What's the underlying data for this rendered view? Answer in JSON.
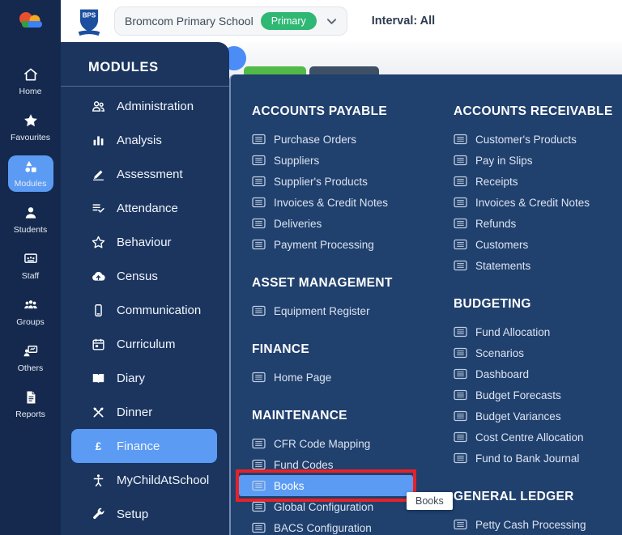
{
  "header": {
    "logo_icon": "bromcom-cloud-icon",
    "crest_icon": "crest-icon",
    "crest_text": "BPS",
    "school_selector": {
      "name": "Bromcom Primary School",
      "badge": "Primary"
    },
    "interval_label": "Interval: All"
  },
  "sidebar": {
    "items": [
      {
        "label": "Home",
        "icon": "home-icon",
        "active": false
      },
      {
        "label": "Favourites",
        "icon": "star-icon",
        "active": false
      },
      {
        "label": "Modules",
        "icon": "shapes-icon",
        "active": true
      },
      {
        "label": "Students",
        "icon": "person-icon",
        "active": false
      },
      {
        "label": "Staff",
        "icon": "staff-icon",
        "active": false
      },
      {
        "label": "Groups",
        "icon": "groups-icon",
        "active": false
      },
      {
        "label": "Others",
        "icon": "others-icon",
        "active": false
      },
      {
        "label": "Reports",
        "icon": "report-icon",
        "active": false
      }
    ]
  },
  "modules_menu": {
    "title": "MODULES",
    "items": [
      {
        "label": "Administration",
        "icon": "people-icon",
        "active": false
      },
      {
        "label": "Analysis",
        "icon": "bar-chart-icon",
        "active": false
      },
      {
        "label": "Assessment",
        "icon": "pencil-icon",
        "active": false
      },
      {
        "label": "Attendance",
        "icon": "list-check-icon",
        "active": false
      },
      {
        "label": "Behaviour",
        "icon": "star-outline-icon",
        "active": false
      },
      {
        "label": "Census",
        "icon": "cloud-upload-icon",
        "active": false
      },
      {
        "label": "Communication",
        "icon": "phone-icon",
        "active": false
      },
      {
        "label": "Curriculum",
        "icon": "calendar-icon",
        "active": false
      },
      {
        "label": "Diary",
        "icon": "book-icon",
        "active": false
      },
      {
        "label": "Dinner",
        "icon": "cutlery-icon",
        "active": false
      },
      {
        "label": "Finance",
        "icon": "pound-icon",
        "active": true
      },
      {
        "label": "MyChildAtSchool",
        "icon": "child-icon",
        "active": false
      },
      {
        "label": "Setup",
        "icon": "wrench-icon",
        "active": false
      }
    ]
  },
  "finance_flyout": {
    "tooltip": "Books",
    "columns": [
      {
        "sections": [
          {
            "title": "ACCOUNTS PAYABLE",
            "items": [
              {
                "label": "Purchase Orders"
              },
              {
                "label": "Suppliers"
              },
              {
                "label": "Supplier's Products"
              },
              {
                "label": "Invoices & Credit Notes"
              },
              {
                "label": "Deliveries"
              },
              {
                "label": "Payment Processing"
              }
            ]
          },
          {
            "title": "ASSET MANAGEMENT",
            "items": [
              {
                "label": "Equipment Register"
              }
            ]
          },
          {
            "title": "FINANCE",
            "items": [
              {
                "label": "Home Page"
              }
            ]
          },
          {
            "title": "MAINTENANCE",
            "items": [
              {
                "label": "CFR Code Mapping"
              },
              {
                "label": "Fund Codes"
              },
              {
                "label": "Books",
                "selected": true,
                "annotated": true
              },
              {
                "label": "Global Configuration"
              },
              {
                "label": "BACS Configuration"
              }
            ]
          }
        ]
      },
      {
        "sections": [
          {
            "title": "ACCOUNTS RECEIVABLE",
            "items": [
              {
                "label": "Customer's Products"
              },
              {
                "label": "Pay in Slips"
              },
              {
                "label": "Receipts"
              },
              {
                "label": "Invoices & Credit Notes"
              },
              {
                "label": "Refunds"
              },
              {
                "label": "Customers"
              },
              {
                "label": "Statements"
              }
            ]
          },
          {
            "title": "BUDGETING",
            "items": [
              {
                "label": "Fund Allocation"
              },
              {
                "label": "Scenarios"
              },
              {
                "label": "Dashboard"
              },
              {
                "label": "Budget Forecasts"
              },
              {
                "label": "Budget Variances"
              },
              {
                "label": "Cost Centre Allocation"
              },
              {
                "label": "Fund to Bank Journal"
              }
            ]
          },
          {
            "title": "GENERAL LEDGER",
            "items": [
              {
                "label": "Petty Cash Processing"
              }
            ]
          }
        ]
      }
    ]
  },
  "colors": {
    "sidebar_bg": "#14294d",
    "modules_panel_bg": "#1b355f",
    "flyout_bg": "#20406e",
    "highlight_blue": "#5b9bf3",
    "annotation_red": "#e82127",
    "badge_green": "#2eb873",
    "peek_button_green": "#53ba48",
    "peek_button_slate": "#3d5065"
  }
}
